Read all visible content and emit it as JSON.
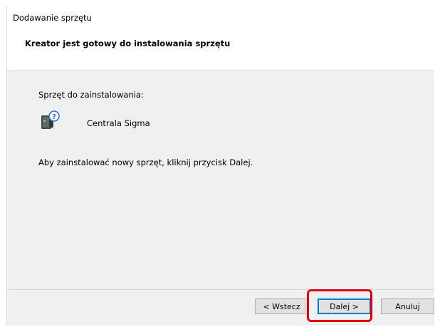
{
  "window": {
    "title": "Dodawanie sprzętu"
  },
  "header": {
    "title": "Kreator jest gotowy do instalowania sprzętu"
  },
  "main": {
    "devices_label": "Sprzęt do zainstalowania:",
    "device": {
      "name": "Centrala Sigma",
      "icon": "unknown-device-icon"
    },
    "instruction": "Aby zainstalować nowy sprzęt, kliknij przycisk Dalej."
  },
  "buttons": {
    "back_label": "< Wstecz",
    "next_label": "Dalej >",
    "cancel_label": "Anuluj"
  },
  "colors": {
    "panel_background": "#f0f0f0",
    "default_button_border": "#0078d7",
    "annotation_highlight": "#e00000"
  }
}
